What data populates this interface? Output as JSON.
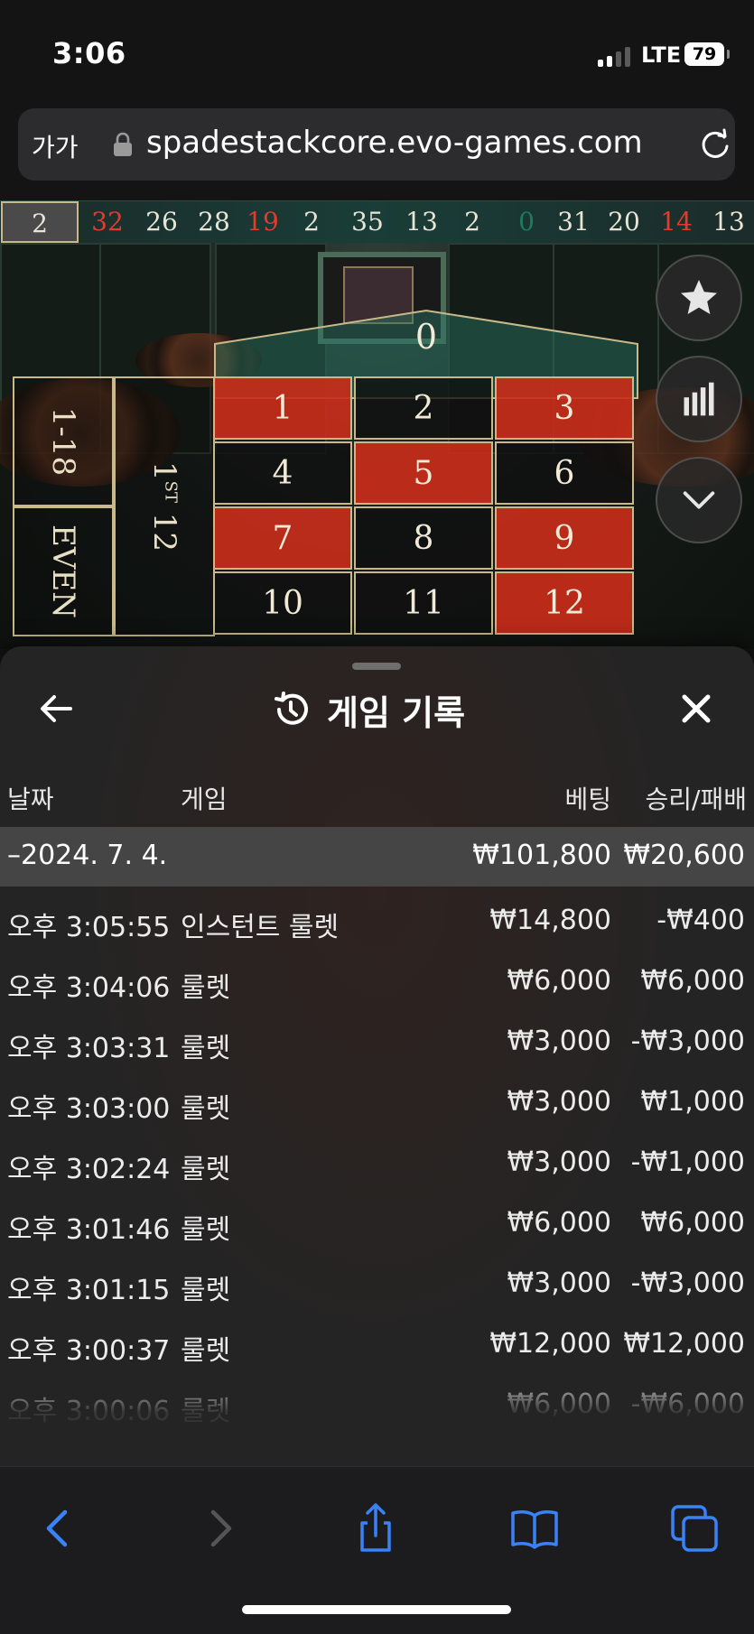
{
  "status_bar": {
    "time": "3:06",
    "network": "LTE",
    "battery": "79"
  },
  "address_bar": {
    "text_size_label": "가가",
    "url": "spadestackcore.evo-games.com"
  },
  "recent_results": [
    {
      "n": "2",
      "c": "first"
    },
    {
      "n": "32",
      "c": "red"
    },
    {
      "n": "26",
      "c": "black"
    },
    {
      "n": "28",
      "c": "black"
    },
    {
      "n": "19",
      "c": "red"
    },
    {
      "n": "2",
      "c": "black"
    },
    {
      "n": "35",
      "c": "black"
    },
    {
      "n": "13",
      "c": "black"
    },
    {
      "n": "2",
      "c": "black"
    },
    {
      "n": "0",
      "c": "green"
    },
    {
      "n": "31",
      "c": "black"
    },
    {
      "n": "20",
      "c": "black"
    },
    {
      "n": "14",
      "c": "red"
    },
    {
      "n": "13",
      "c": "black"
    }
  ],
  "table": {
    "zero": "0",
    "numbers": [
      {
        "n": "1",
        "c": "red"
      },
      {
        "n": "2",
        "c": "black"
      },
      {
        "n": "3",
        "c": "red"
      },
      {
        "n": "4",
        "c": "black"
      },
      {
        "n": "5",
        "c": "red"
      },
      {
        "n": "6",
        "c": "black"
      },
      {
        "n": "7",
        "c": "red"
      },
      {
        "n": "8",
        "c": "black"
      },
      {
        "n": "9",
        "c": "red"
      },
      {
        "n": "10",
        "c": "black"
      },
      {
        "n": "11",
        "c": "black"
      },
      {
        "n": "12",
        "c": "red"
      }
    ],
    "low_bet": "1-18",
    "even_bet": "EVEN",
    "dozen_number": "1",
    "dozen_suffix": "ST",
    "dozen_value": "12",
    "colors": {
      "red": "#c82c1a",
      "felt_green": "#1f7a5a",
      "border_gold": "#c9b98a"
    }
  },
  "side_buttons": [
    "star-icon",
    "stats-icon",
    "chevron-down-icon"
  ],
  "history": {
    "title": "게임 기록",
    "columns": {
      "date": "날짜",
      "game": "게임",
      "bet": "베팅",
      "result": "승리/패배"
    },
    "date_group": {
      "label": "–2024. 7. 4.",
      "bet": "₩101,800",
      "result": "₩20,600"
    },
    "rows": [
      {
        "time": "오후 3:05:55",
        "game": "인스턴트 룰렛",
        "bet": "₩14,800",
        "result": "-₩400"
      },
      {
        "time": "오후 3:04:06",
        "game": "룰렛",
        "bet": "₩6,000",
        "result": "₩6,000"
      },
      {
        "time": "오후 3:03:31",
        "game": "룰렛",
        "bet": "₩3,000",
        "result": "-₩3,000"
      },
      {
        "time": "오후 3:03:00",
        "game": "룰렛",
        "bet": "₩3,000",
        "result": "₩1,000"
      },
      {
        "time": "오후 3:02:24",
        "game": "룰렛",
        "bet": "₩3,000",
        "result": "-₩1,000"
      },
      {
        "time": "오후 3:01:46",
        "game": "룰렛",
        "bet": "₩6,000",
        "result": "₩6,000"
      },
      {
        "time": "오후 3:01:15",
        "game": "룰렛",
        "bet": "₩3,000",
        "result": "-₩3,000"
      },
      {
        "time": "오후 3:00:37",
        "game": "룰렛",
        "bet": "₩12,000",
        "result": "₩12,000"
      },
      {
        "time": "오후 3:00:06",
        "game": "룰렛",
        "bet": "₩6,000",
        "result": "-₩6,000"
      }
    ]
  },
  "toolbar": [
    "back-icon",
    "forward-icon",
    "share-icon",
    "bookmarks-icon",
    "tabs-icon"
  ],
  "accent_color": "#3a82f7"
}
